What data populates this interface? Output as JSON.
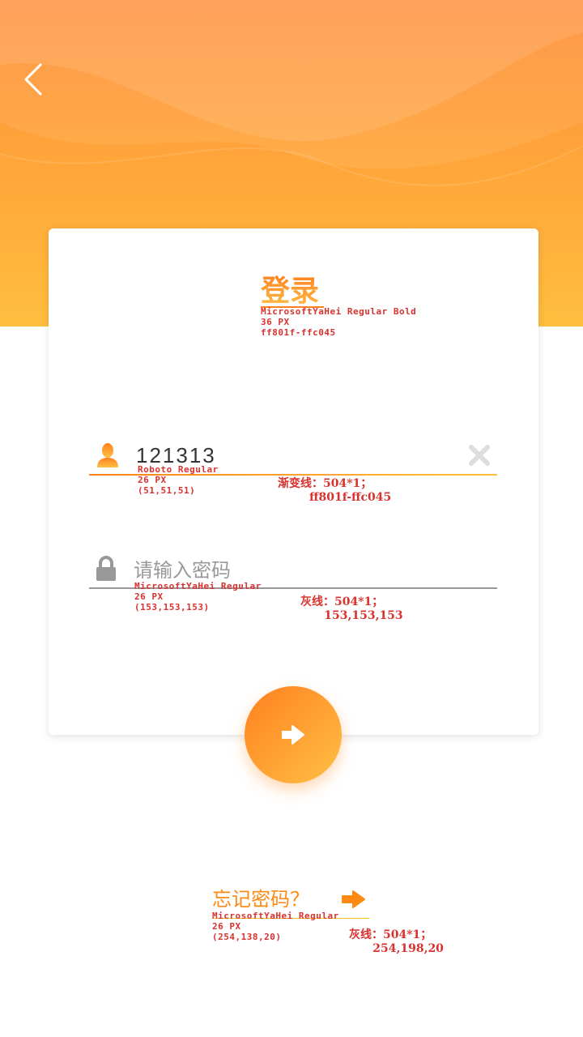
{
  "header": {
    "back_icon": "chevron-left-icon"
  },
  "login": {
    "title": "登录",
    "title_note": "MicrosoftYaHei Regular Bold\n36 PX\nff801f-ffc045",
    "gradient_colors": [
      "#ff801f",
      "#ffc045"
    ],
    "username_value": "121313",
    "username_note": "Roboto Regular\n26 PX\n(51,51,51)",
    "username_line_note": "渐变线：504*1；\n        ff801f-ffc045",
    "password_placeholder": "请输入密码",
    "password_note": "MicrosoftYaHei Regular\n26 PX\n(153,153,153)",
    "password_line_note": "灰线：504*1；\n      153,153,153",
    "user_icon": "user-icon",
    "lock_icon": "lock-icon",
    "clear_icon": "close-icon",
    "submit_icon": "arrow-right-icon"
  },
  "forgot": {
    "label": "忘记密码？",
    "note": "MicrosoftYaHei Regular\n26 PX\n(254,138,20)",
    "line_note": "灰线：504*1；\n      254,198,20",
    "arrow_icon": "arrow-right-icon",
    "color": "#fe8a14"
  }
}
